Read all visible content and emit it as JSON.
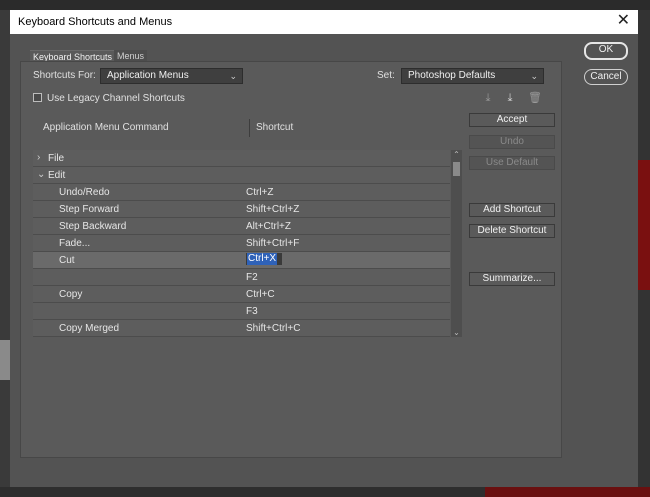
{
  "window": {
    "title": "Keyboard Shortcuts and Menus",
    "close_icon": "close-icon"
  },
  "tabs": [
    {
      "label": "Keyboard Shortcuts"
    },
    {
      "label": "Menus"
    }
  ],
  "shortcuts_for": {
    "label": "Shortcuts For:",
    "value": "Application Menus"
  },
  "set": {
    "label": "Set:",
    "value": "Photoshop Defaults"
  },
  "legacy": {
    "label": "Use Legacy Channel Shortcuts",
    "checked": false
  },
  "columns": {
    "command": "Application Menu Command",
    "shortcut": "Shortcut"
  },
  "rows": [
    {
      "command": "File",
      "shortcut": "",
      "type": "group",
      "expanded": false
    },
    {
      "command": "Edit",
      "shortcut": "",
      "type": "group",
      "expanded": true
    },
    {
      "command": "Undo/Redo",
      "shortcut": "Ctrl+Z",
      "type": "item"
    },
    {
      "command": "Step Forward",
      "shortcut": "Shift+Ctrl+Z",
      "type": "item"
    },
    {
      "command": "Step Backward",
      "shortcut": "Alt+Ctrl+Z",
      "type": "item"
    },
    {
      "command": "Fade...",
      "shortcut": "Shift+Ctrl+F",
      "type": "item"
    },
    {
      "command": "Cut",
      "shortcut": "Ctrl+X",
      "type": "item",
      "selected": true,
      "editing": true
    },
    {
      "command": "",
      "shortcut": "F2",
      "type": "item"
    },
    {
      "command": "Copy",
      "shortcut": "Ctrl+C",
      "type": "item"
    },
    {
      "command": "",
      "shortcut": "F3",
      "type": "item"
    },
    {
      "command": "Copy Merged",
      "shortcut": "Shift+Ctrl+C",
      "type": "item"
    }
  ],
  "buttons": {
    "accept": "Accept",
    "undo": "Undo",
    "use_default": "Use Default",
    "add_shortcut": "Add Shortcut",
    "delete_shortcut": "Delete Shortcut",
    "summarize": "Summarize...",
    "ok": "OK",
    "cancel": "Cancel"
  },
  "colors": {
    "dialog_bg": "#535353",
    "selection": "#2f62b8"
  }
}
